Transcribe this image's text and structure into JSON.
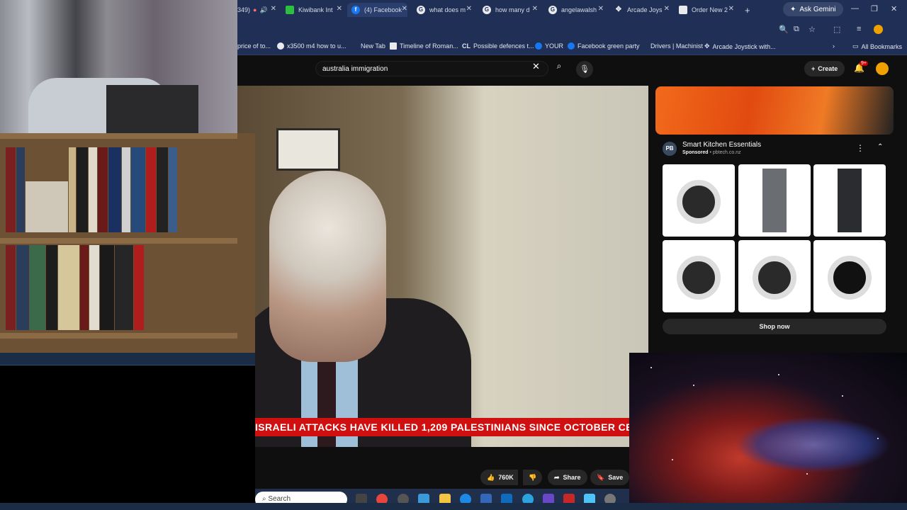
{
  "browser": {
    "tabs": [
      {
        "label": "349)",
        "partial": true
      },
      {
        "label": "Kiwibank Int"
      },
      {
        "label": "(4) Facebook",
        "active": true
      },
      {
        "label": "what does m"
      },
      {
        "label": "how many d"
      },
      {
        "label": "angelawalsh"
      },
      {
        "label": "Arcade Joys"
      },
      {
        "label": "Order New 2"
      }
    ],
    "new_tab_icon": "plus-icon",
    "ask_gemini": "Ask Gemini",
    "bookmarks": [
      {
        "label": "price of to..."
      },
      {
        "label": "x3500 m4 how to u..."
      },
      {
        "label": "New Tab"
      },
      {
        "label": "Timeline of Roman..."
      },
      {
        "label": "Possible defences t..."
      },
      {
        "label": "YOUR"
      },
      {
        "label": "Facebook green party"
      },
      {
        "label": "Drivers | Machinist"
      },
      {
        "label": "Arcade Joystick with..."
      }
    ],
    "all_bookmarks": "All Bookmarks"
  },
  "youtube": {
    "search_value": "australia immigration",
    "create_label": "Create",
    "notification_count": "9+",
    "ticker": "ISRAELI ATTACKS HAVE KILLED 1,209 PALESTINIANS SINCE OCTOBER CE",
    "like_count": "760K",
    "share_label": "Share",
    "save_label": "Save"
  },
  "ad": {
    "logo": "PB",
    "title": "Smart Kitchen Essentials",
    "sponsored": "Sponsored",
    "domain": "pbtech.co.nz",
    "shop_now": "Shop now"
  },
  "taskbar": {
    "search_label": "Search"
  },
  "colors": {
    "chrome_frame": "#1f2f56",
    "yt_bg": "#0f0f0f",
    "ticker_red": "#d01010",
    "taskbar": "#202f4c"
  }
}
